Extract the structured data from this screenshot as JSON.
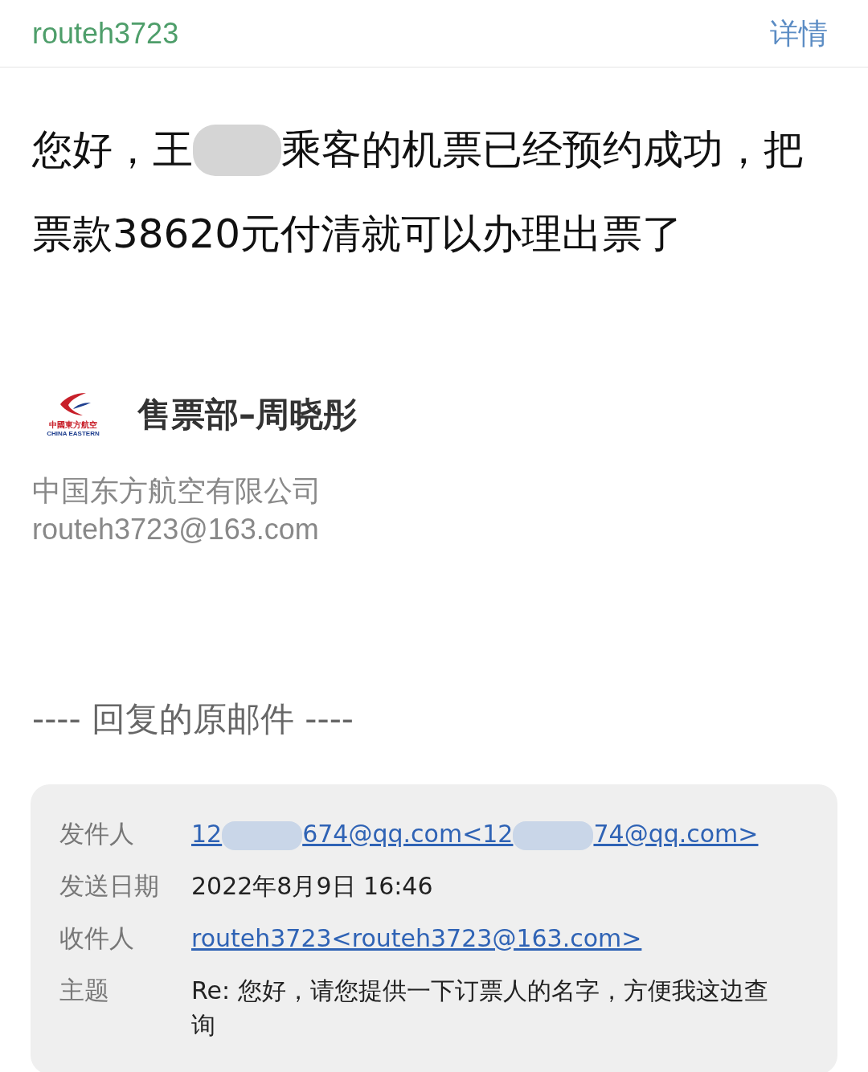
{
  "header": {
    "sender": "routeh3723",
    "details_link": "详情"
  },
  "greeting_lines": [
    [
      "您好，王",
      "乘客的机票已经预约成功，把"
    ],
    [
      "票款38620元付清就可以办理出票了"
    ]
  ],
  "signature": {
    "logo_cn": "中國東方航空",
    "logo_en": "CHINA EASTERN",
    "name": "售票部–周晓彤",
    "company": "中国东方航空有限公司",
    "email": "routeh3723@163.com"
  },
  "quote_divider": "---- 回复的原邮件 ----",
  "original_mail": [
    {
      "label": "发件人",
      "kind": "link",
      "parts": [
        "12",
        "674@qq.com<12",
        "74@qq.com>"
      ]
    },
    {
      "label": "发送日期",
      "kind": "text",
      "parts": [
        "2022年8月9日 16:46"
      ]
    },
    {
      "label": "收件人",
      "kind": "link",
      "parts": [
        "routeh3723<routeh3723@163.com>"
      ]
    },
    {
      "label": "主题",
      "kind": "text",
      "parts": [
        "Re: 您好，请您提供一下订票人的名字，方便我这边查询"
      ]
    }
  ]
}
